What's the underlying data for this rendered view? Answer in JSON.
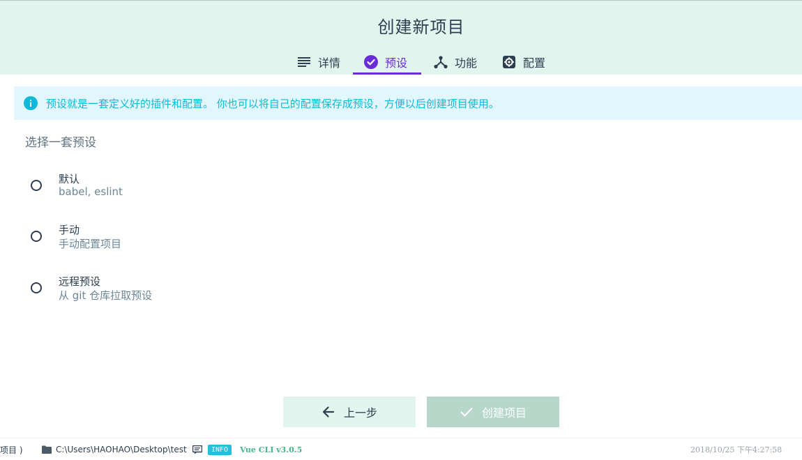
{
  "header": {
    "title": "创建新项目",
    "tabs": [
      {
        "label": "详情",
        "icon": "list-icon"
      },
      {
        "label": "预设",
        "icon": "check-circle-icon",
        "active": true
      },
      {
        "label": "功能",
        "icon": "fork-icon"
      },
      {
        "label": "配置",
        "icon": "gear-icon"
      }
    ]
  },
  "info": {
    "text": "预设就是一套定义好的插件和配置。 你也可以将自己的配置保存成预设，方便以后创建项目使用。",
    "icon": "info-icon"
  },
  "presets": {
    "title": "选择一套预设",
    "options": [
      {
        "name": "默认",
        "desc": "babel, eslint"
      },
      {
        "name": "手动",
        "desc": "手动配置项目"
      },
      {
        "name": "远程预设",
        "desc": "从 git 仓库拉取预设"
      }
    ]
  },
  "actions": {
    "prev_label": "上一步",
    "create_label": "创建项目"
  },
  "statusbar": {
    "project_label": "项目 )",
    "path": "C:\\Users\\HAOHAO\\Desktop\\test",
    "log_level": "INFO",
    "version": "Vue CLI v3.0.5",
    "datetime": "2018/10/25 下午4:27:58"
  },
  "colors": {
    "accent": "#6a2cd8",
    "header_bg": "#e1f5ee",
    "info": "#0fb9d9",
    "vue_green": "#42b983"
  }
}
